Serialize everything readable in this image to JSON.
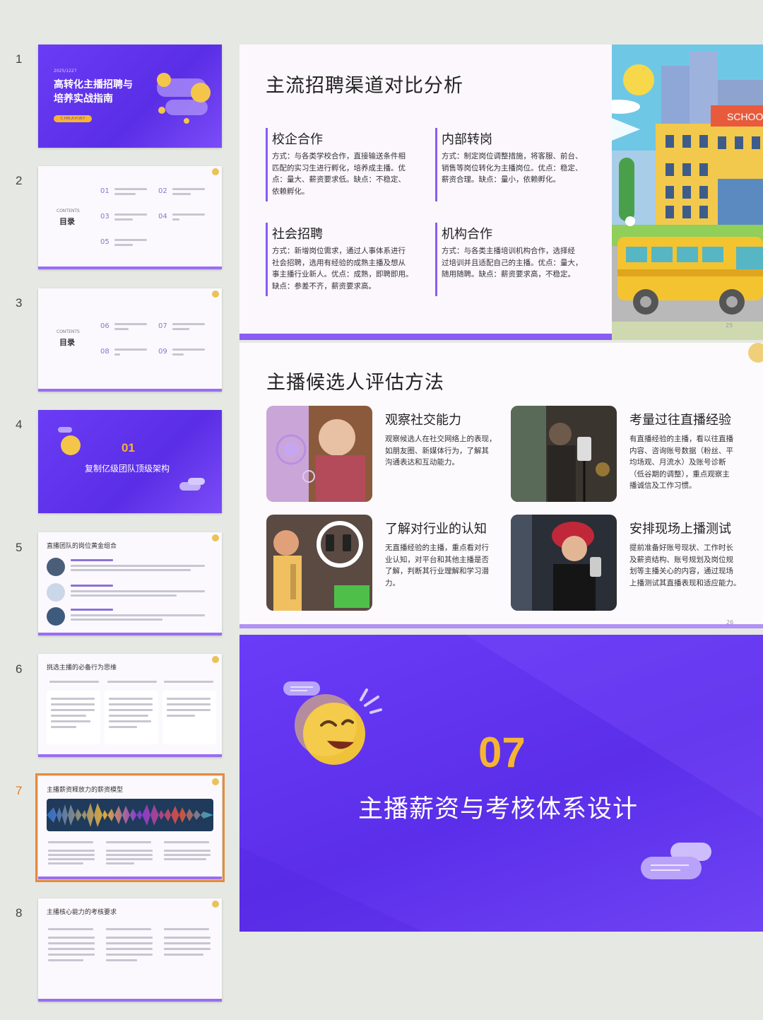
{
  "thumbnails": {
    "numbers": [
      "1",
      "2",
      "3",
      "4",
      "5",
      "6",
      "7",
      "8"
    ],
    "slide1": {
      "year": "2025/1227",
      "title_line1": "高转化主播招聘与",
      "title_line2": "培养实战指南",
      "button": "C.HAI.A.H.W.Y"
    },
    "slide2": {
      "contents_en": "CONTENTS",
      "contents": "目录",
      "nums": [
        "01",
        "02",
        "03",
        "04",
        "05"
      ]
    },
    "slide3": {
      "contents_en": "CONTENTS",
      "contents": "目录",
      "nums": [
        "06",
        "07",
        "08",
        "09"
      ]
    },
    "slide4": {
      "num": "01",
      "title": "复制亿级团队顶级架构"
    },
    "slide5": {
      "title": "直播团队的岗位黄金组合"
    },
    "slide6": {
      "title": "挑选主播的必备行为思维"
    },
    "slide7": {
      "title": "主播薪资释放力的薪资模型"
    },
    "slide8": {
      "title": "主播核心能力的考核要求"
    }
  },
  "slide25": {
    "title": "主流招聘渠道对比分析",
    "page": "25",
    "school_sign": "SCHOOL",
    "channels": [
      {
        "title": "校企合作",
        "body": [
          "方式：与各类学校合作，直接输送条件相",
          "匹配的实习生进行孵化，培养成主播。优",
          "点：量大、薪资要求低。缺点：不稳定、",
          "依赖孵化。"
        ]
      },
      {
        "title": "内部转岗",
        "body": [
          "方式：制定岗位调整措施，将客服、前台、",
          "销售等岗位转化为主播岗位。优点：稳定、",
          "薪资合理。缺点：量小，依赖孵化。"
        ]
      },
      {
        "title": "社会招聘",
        "body": [
          "方式：新增岗位需求，通过人事体系进行",
          "社会招聘，选用有经验的成熟主播及想从",
          "事主播行业新人。优点：成熟，即聘即用。",
          "缺点：参差不齐，薪资要求高。"
        ]
      },
      {
        "title": "机构合作",
        "body": [
          "方式：与各类主播培训机构合作，选择经",
          "过培训并且适配自己的主播。优点：量大，",
          "随用随聘。缺点：薪资要求高，不稳定。"
        ]
      }
    ]
  },
  "slide26": {
    "title": "主播候选人评估方法",
    "page": "26",
    "methods": [
      {
        "title": "观察社交能力",
        "body": [
          "观察候选人在社交网络上的表现，",
          "如朋友圈、新媒体行为，了解其",
          "沟通表达和互动能力。"
        ]
      },
      {
        "title": "考量过往直播经验",
        "body": [
          "有直播经验的主播，看以往直播",
          "内容、咨询账号数据（粉丝、平",
          "均场观、月流水）及账号诊断",
          "（低谷期的调整），重点观察主",
          "播诚信及工作习惯。"
        ]
      },
      {
        "title": "了解对行业的认知",
        "body": [
          "无直播经验的主播，重点看对行",
          "业认知，对平台和其他主播是否",
          "了解，判断其行业理解和学习潜",
          "力。"
        ]
      },
      {
        "title": "安排现场上播测试",
        "body": [
          "提前准备好账号现状、工作时长",
          "及薪资结构、账号规划及岗位规",
          "划等主播关心的内容，通过现场",
          "上播测试其直播表现和适应能力。"
        ]
      }
    ]
  },
  "slide27": {
    "number": "07",
    "title": "主播薪资与考核体系设计"
  },
  "colors": {
    "accent_purple": "#6b3cf8",
    "selection_orange": "#e58a3e",
    "number_gold": "#f5b533"
  }
}
